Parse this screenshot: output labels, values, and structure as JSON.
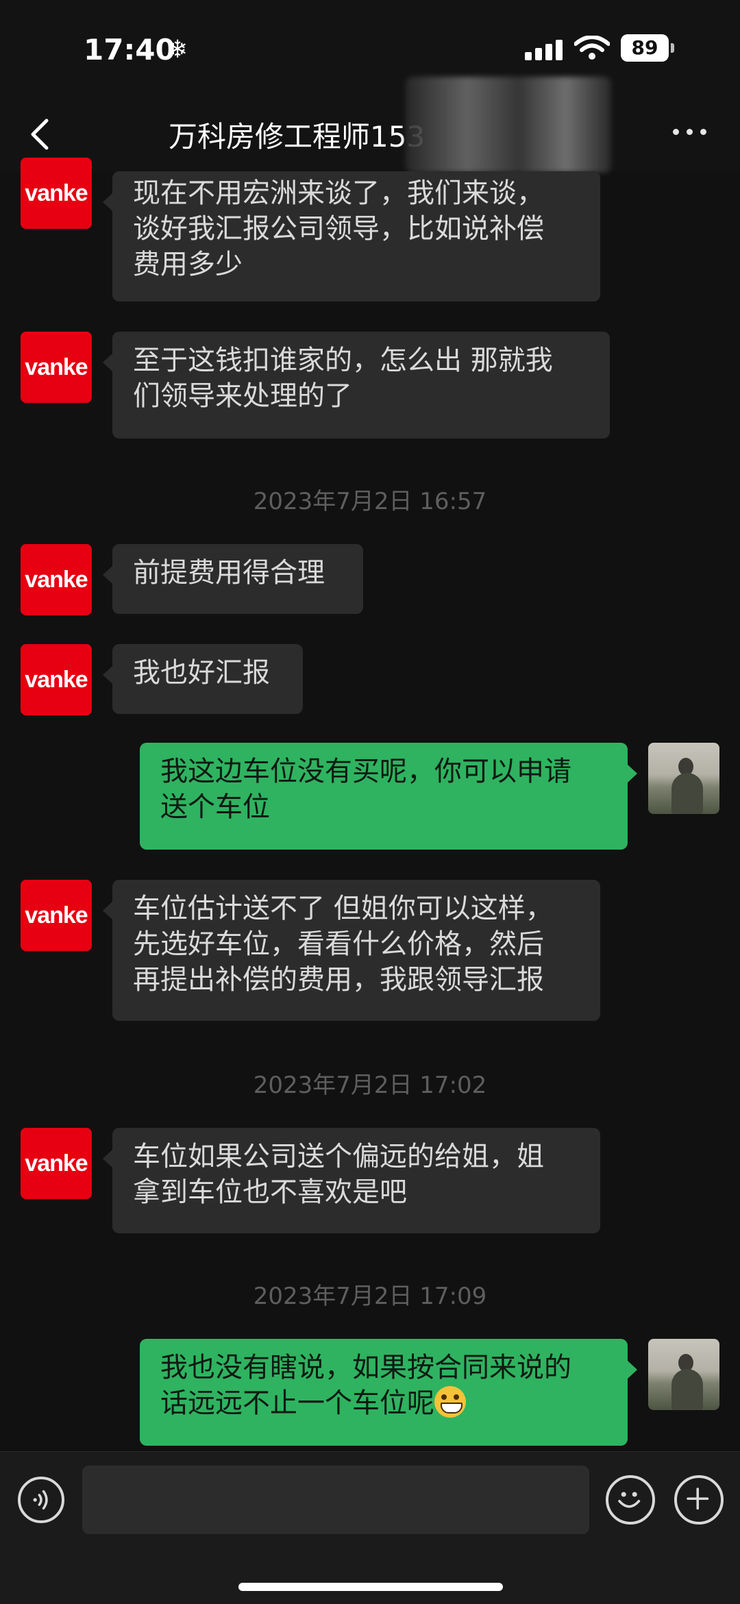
{
  "status_bar": {
    "time": "17:40",
    "battery": "89"
  },
  "header": {
    "title": "万科房修工程师153"
  },
  "messages": [
    {
      "lines": [
        "现在不用宏洲来谈了，我们来谈，",
        "谈好我汇报公司领导，比如说补偿",
        "费用多少"
      ]
    },
    {
      "lines": [
        "至于这钱扣谁家的，怎么出 那就我",
        "们领导来处理的了"
      ]
    },
    {
      "lines": [
        "前提费用得合理"
      ]
    },
    {
      "lines": [
        "我也好汇报"
      ]
    },
    {
      "lines": [
        "我这边车位没有买呢，你可以申请",
        "送个车位"
      ]
    },
    {
      "lines": [
        "车位估计送不了 但姐你可以这样，",
        "先选好车位，看看什么价格，然后",
        "再提出补偿的费用，我跟领导汇报"
      ]
    },
    {
      "lines": [
        "车位如果公司送个偏远的给姐，姐",
        "拿到车位也不喜欢是吧"
      ]
    },
    {
      "lines": [
        "我也没有瞎说，如果按合同来说的",
        "话远远不止一个车位呢"
      ]
    }
  ],
  "timestamps": [
    "2023年7月2日 16:57",
    "2023年7月2日 17:02",
    "2023年7月2日 17:09"
  ],
  "avatar_label": "vanke",
  "colors": {
    "background": "#111111",
    "incoming_bubble": "#2c2c2c",
    "outgoing_bubble": "#2fb360",
    "vanke_red": "#e60012"
  }
}
